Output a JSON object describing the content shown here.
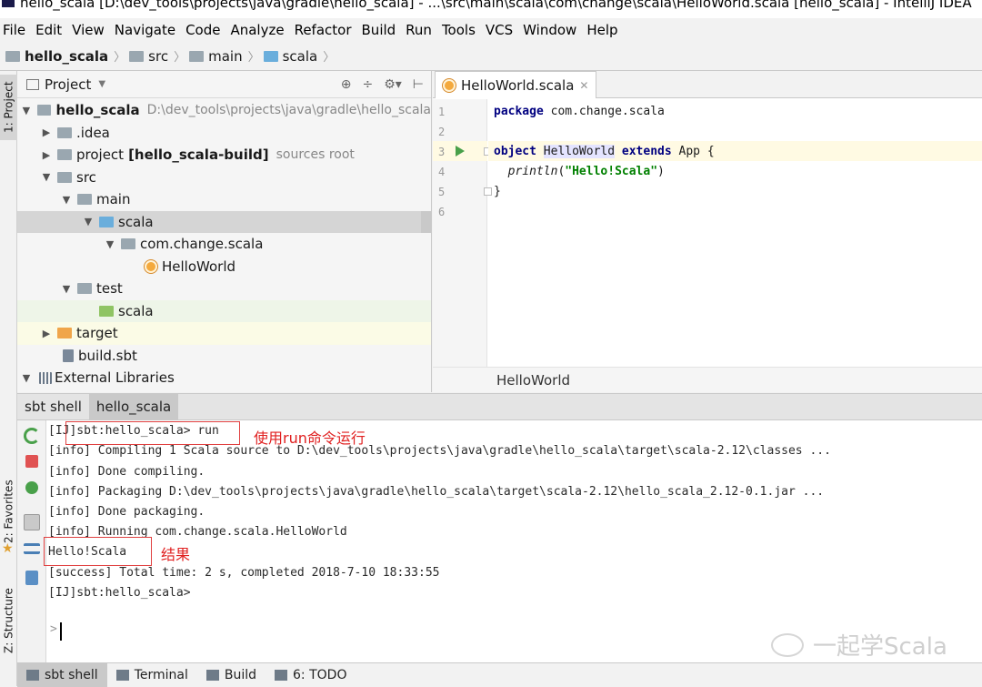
{
  "window": {
    "title": "hello_scala [D:\\dev_tools\\projects\\java\\gradle\\hello_scala] - ...\\src\\main\\scala\\com\\change\\scala\\HelloWorld.scala [hello_scala] - IntelliJ IDEA"
  },
  "menu": [
    "File",
    "Edit",
    "View",
    "Navigate",
    "Code",
    "Analyze",
    "Refactor",
    "Build",
    "Run",
    "Tools",
    "VCS",
    "Window",
    "Help"
  ],
  "breadcrumb": [
    "hello_scala",
    "src",
    "main",
    "scala"
  ],
  "side_tabs": {
    "project": "1: Project",
    "favorites": "2: Favorites",
    "structure": "Z: Structure"
  },
  "project_panel": {
    "title": "Project",
    "tree": [
      {
        "label": "hello_scala",
        "extra": "D:\\dev_tools\\projects\\java\\gradle\\hello_scala"
      },
      {
        "label": ".idea"
      },
      {
        "label": "project",
        "bold": "[hello_scala-build]",
        "extra": "sources root"
      },
      {
        "label": "src"
      },
      {
        "label": "main"
      },
      {
        "label": "scala"
      },
      {
        "label": "com.change.scala"
      },
      {
        "label": "HelloWorld"
      },
      {
        "label": "test"
      },
      {
        "label": "scala"
      },
      {
        "label": "target"
      },
      {
        "label": "build.sbt"
      },
      {
        "label": "External Libraries"
      }
    ]
  },
  "editor": {
    "tab": "HelloWorld.scala",
    "line_numbers": [
      "1",
      "2",
      "3",
      "4",
      "5",
      "6"
    ],
    "code": {
      "l1_kw": "package",
      "l1_rest": "com.change.scala",
      "l3_kw": "object",
      "l3_name": "HelloWorld",
      "l3_kw2": "extends",
      "l3_rest": "App {",
      "l4_fn": "println",
      "l4_open": "(",
      "l4_str": "\"Hello!Scala\"",
      "l4_close": ")",
      "l5": "}"
    },
    "footer": "HelloWorld"
  },
  "bottom_tabs": [
    "sbt shell",
    "hello_scala"
  ],
  "console": {
    "lines": [
      "[IJ]sbt:hello_scala> run",
      "[info] Compiling 1 Scala source to D:\\dev_tools\\projects\\java\\gradle\\hello_scala\\target\\scala-2.12\\classes ...",
      "[info] Done compiling.",
      "[info] Packaging D:\\dev_tools\\projects\\java\\gradle\\hello_scala\\target\\scala-2.12\\hello_scala_2.12-0.1.jar ...",
      "[info] Done packaging.",
      "[info] Running com.change.scala.HelloWorld",
      "Hello!Scala",
      "[success] Total time: 2 s, completed 2018-7-10 18:33:55",
      "[IJ]sbt:hello_scala>"
    ],
    "prompt": ">",
    "annotations": {
      "run": "使用run命令运行",
      "result": "结果"
    }
  },
  "watermark": "一起学Scala",
  "status_tabs": [
    "sbt shell",
    "Terminal",
    "Build",
    "6: TODO"
  ],
  "colors": {
    "annotation": "#e02020",
    "keyword": "#000080",
    "string": "#008000",
    "selection": "#d5d5d5"
  }
}
